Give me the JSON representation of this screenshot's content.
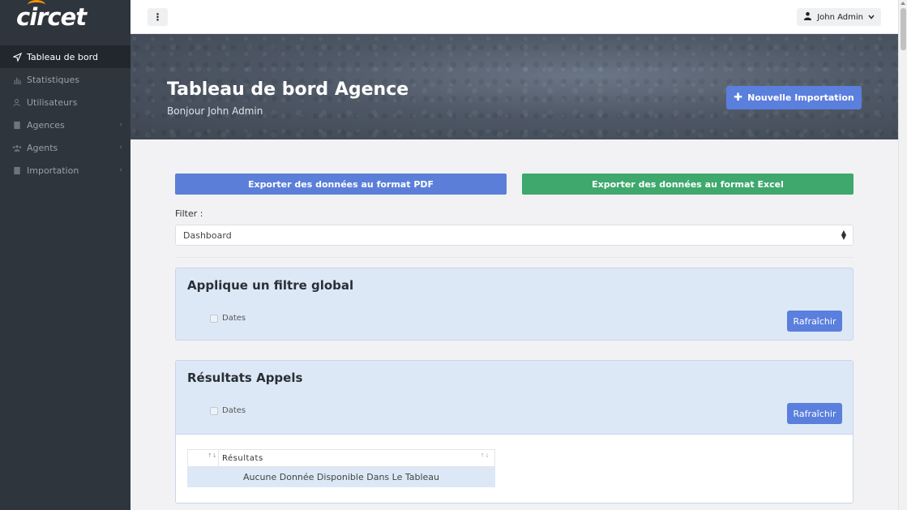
{
  "app": {
    "logo_text": "circet"
  },
  "sidebar": {
    "items": [
      {
        "label": "Tableau de bord",
        "icon": "send-icon",
        "active": true
      },
      {
        "label": "Statistiques",
        "icon": "bar-chart-icon"
      },
      {
        "label": "Utilisateurs",
        "icon": "users-icon"
      },
      {
        "label": "Agences",
        "icon": "building-icon",
        "chevron": "‹"
      },
      {
        "label": "Agents",
        "icon": "group-icon",
        "chevron": "‹"
      },
      {
        "label": "Importation",
        "icon": "building-icon",
        "chevron": "‹"
      }
    ]
  },
  "topbar": {
    "menu_icon": "⋮",
    "user_name": "John Admin"
  },
  "hero": {
    "title": "Tableau de bord Agence",
    "subtitle": "Bonjour John Admin",
    "new_import_label": "Nouvelle Importation"
  },
  "main": {
    "export_pdf_label": "Exporter des données au format PDF",
    "export_excel_label": "Exporter des données au format Excel",
    "filter_label": "Filter :",
    "filter_value": "Dashboard",
    "card_global": {
      "title": "Applique un filtre global",
      "checkbox_label": "Dates",
      "refresh_label": "Rafraîchir"
    },
    "card_results": {
      "title": "Résultats Appels",
      "checkbox_label": "Dates",
      "refresh_label": "Rafraîchir",
      "table": {
        "columns": [
          "Résultats"
        ],
        "empty_text": "Aucune Donnée Disponible Dans Le Tableau"
      }
    }
  },
  "colors": {
    "sidebar_bg": "#2f353d",
    "primary": "#5a7fdd",
    "success": "#3ea86d",
    "card_bg": "#dde8f6",
    "logo_accent": "#f39200"
  }
}
